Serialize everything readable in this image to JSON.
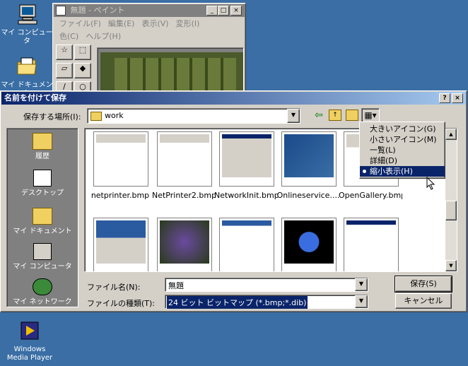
{
  "desktop": {
    "icons": [
      {
        "label": "マイ コンピュータ"
      },
      {
        "label": "マイ ドキュメント"
      },
      {
        "label": "Windows Media Player"
      }
    ]
  },
  "paint": {
    "title": "無題 - ペイント",
    "menu": [
      "ファイル(F)",
      "編集(E)",
      "表示(V)",
      "変形(I)",
      "色(C)",
      "ヘルプ(H)"
    ]
  },
  "dialog": {
    "title": "名前を付けて保存",
    "save_in_label": "保存する場所(I):",
    "save_in_value": "work",
    "places": [
      "履歴",
      "デスクトップ",
      "マイ ドキュメント",
      "マイ コンピュータ",
      "マイ ネットワーク"
    ],
    "files": [
      {
        "name": "netprinter.bmp"
      },
      {
        "name": "NetPrinter2.bmp"
      },
      {
        "name": "NetworkInit.bmp"
      },
      {
        "name": "Onlineservice...."
      },
      {
        "name": "OpenGallery.bmp"
      },
      {
        "name": ""
      },
      {
        "name": ""
      },
      {
        "name": ""
      },
      {
        "name": ""
      },
      {
        "name": ""
      }
    ],
    "filename_label": "ファイル名(N):",
    "filename_value": "無題",
    "filetype_label": "ファイルの種類(T):",
    "filetype_value": "24 ビット ビットマップ (*.bmp;*.dib)",
    "save_button": "保存(S)",
    "cancel_button": "キャンセル",
    "help_button": "?",
    "close_button": "×"
  },
  "view_menu": {
    "items": [
      {
        "label": "大きいアイコン(G)",
        "selected": false
      },
      {
        "label": "小さいアイコン(M)",
        "selected": false
      },
      {
        "label": "一覧(L)",
        "selected": false
      },
      {
        "label": "詳細(D)",
        "selected": false
      },
      {
        "label": "縮小表示(H)",
        "selected": true
      }
    ]
  },
  "colors": {
    "desktop": "#3a6ea5",
    "title_active": "#0a246a",
    "face": "#d4d0c8",
    "selection": "#0a246a"
  }
}
